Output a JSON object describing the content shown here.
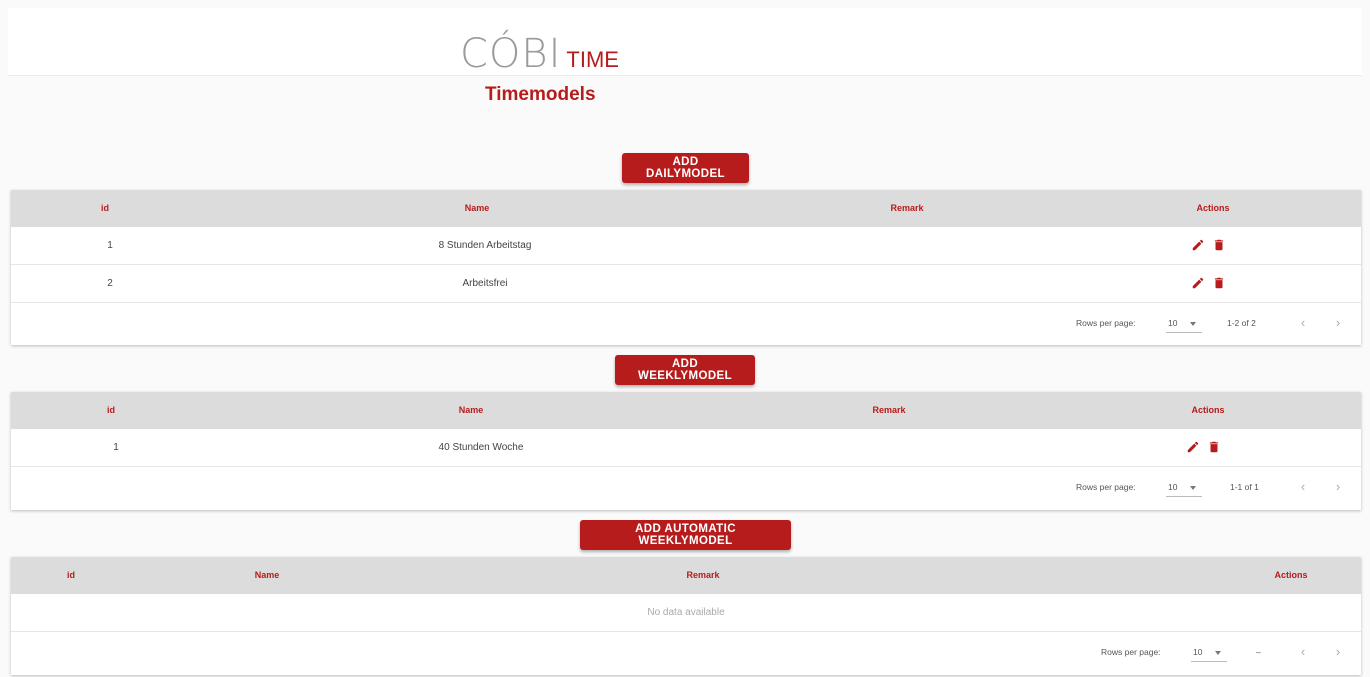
{
  "header": {
    "logo_main": "CÓBI",
    "logo_sub": "TIME"
  },
  "page": {
    "title": "Timemodels"
  },
  "colors": {
    "accent": "#b71c1c",
    "header_bg": "#dcdcdc",
    "page_bg": "#fafafa"
  },
  "daily": {
    "add_label": "ADD DAILYMODEL",
    "columns": {
      "id": "id",
      "name": "Name",
      "remark": "Remark",
      "actions": "Actions"
    },
    "rows": [
      {
        "id": "1",
        "name": "8 Stunden Arbeitstag",
        "remark": ""
      },
      {
        "id": "2",
        "name": "Arbeitsfrei",
        "remark": ""
      }
    ],
    "footer": {
      "rows_per_page_label": "Rows per page:",
      "rows_per_page": "10",
      "range": "1-2 of 2"
    }
  },
  "weekly": {
    "add_label": "ADD WEEKLYMODEL",
    "columns": {
      "id": "id",
      "name": "Name",
      "remark": "Remark",
      "actions": "Actions"
    },
    "rows": [
      {
        "id": "1",
        "name": "40 Stunden Woche",
        "remark": ""
      }
    ],
    "footer": {
      "rows_per_page_label": "Rows per page:",
      "rows_per_page": "10",
      "range": "1-1 of 1"
    }
  },
  "auto_weekly": {
    "add_label": "ADD AUTOMATIC WEEKLYMODEL",
    "columns": {
      "id": "id",
      "name": "Name",
      "remark": "Remark",
      "actions": "Actions"
    },
    "empty_text": "No data available",
    "footer": {
      "rows_per_page_label": "Rows per page:",
      "rows_per_page": "10",
      "range": "–"
    }
  },
  "icons": {
    "edit": "pencil-icon",
    "delete": "trash-icon",
    "prev": "chevron-left-icon",
    "next": "chevron-right-icon",
    "dropdown": "caret-down-icon"
  }
}
